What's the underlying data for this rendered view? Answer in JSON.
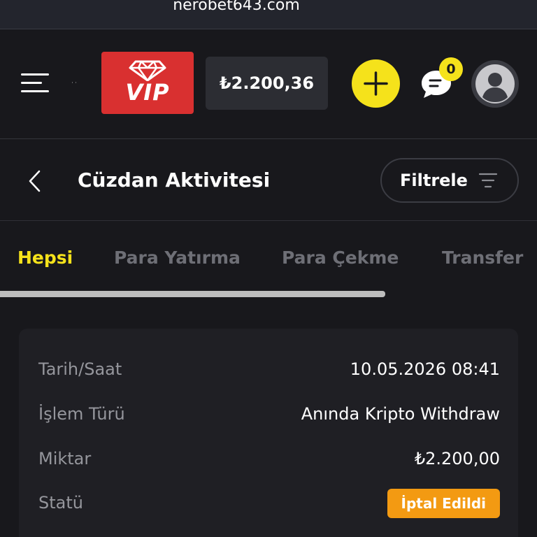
{
  "browser": {
    "url": "nerobet643.com"
  },
  "header": {
    "vip_label": "VIP",
    "balance": "₺2.200,36",
    "notification_count": "0"
  },
  "subheader": {
    "title": "Cüzdan Aktivitesi",
    "filter_label": "Filtrele"
  },
  "tabs": [
    {
      "label": "Hepsi",
      "active": true
    },
    {
      "label": "Para Yatırma",
      "active": false
    },
    {
      "label": "Para Çekme",
      "active": false
    },
    {
      "label": "Transfer",
      "active": false
    }
  ],
  "transaction": {
    "rows": [
      {
        "label": "Tarih/Saat",
        "value": "10.05.2026 08:41"
      },
      {
        "label": "İşlem Türü",
        "value": "Anında Kripto Withdraw"
      },
      {
        "label": "Miktar",
        "value": "₺2.200,00"
      },
      {
        "label": "Statü",
        "value": "İptal Edildi"
      }
    ]
  },
  "colors": {
    "background": "#18181c",
    "accent_yellow": "#f5e21b",
    "vip_red": "#d93030",
    "status_orange": "#f39a12"
  },
  "icons": [
    "menu-icon",
    "diamond-icon",
    "plus-icon",
    "chat-icon",
    "user-icon",
    "chevron-left-icon",
    "filter-icon"
  ]
}
